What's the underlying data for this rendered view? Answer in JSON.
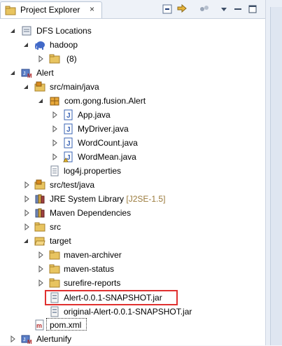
{
  "view": {
    "title": "Project Explorer",
    "close_glyph": "×"
  },
  "tree": {
    "dfs": {
      "label": "DFS Locations"
    },
    "hadoop": {
      "label": "hadoop"
    },
    "hadoop_child": {
      "label": "(8)"
    },
    "alert": {
      "label": "Alert"
    },
    "src_main_java": {
      "label": "src/main/java"
    },
    "package": {
      "label": "com.gong.fusion.Alert"
    },
    "app": {
      "label": "App.java"
    },
    "mydriver": {
      "label": "MyDriver.java"
    },
    "wordcount": {
      "label": "WordCount.java"
    },
    "wordmean": {
      "label": "WordMean.java"
    },
    "log4j": {
      "label": "log4j.properties"
    },
    "src_test_java": {
      "label": "src/test/java"
    },
    "jre": {
      "label": "JRE System Library",
      "decoration": "[J2SE-1.5]"
    },
    "maven": {
      "label": "Maven Dependencies"
    },
    "src": {
      "label": "src"
    },
    "target": {
      "label": "target"
    },
    "maven_archiver": {
      "label": "maven-archiver"
    },
    "maven_status": {
      "label": "maven-status"
    },
    "surefire": {
      "label": "surefire-reports"
    },
    "jar": {
      "label": "Alert-0.0.1-SNAPSHOT.jar"
    },
    "orig_jar": {
      "label": "original-Alert-0.0.1-SNAPSHOT.jar"
    },
    "pom": {
      "label": "pom.xml"
    },
    "alertunify": {
      "label": "Alertunify"
    }
  },
  "colors": {
    "highlight": "#e0302f",
    "folder": "#e8c460",
    "package_icon": "#d88a1e",
    "java_icon": "#3a63b3"
  }
}
